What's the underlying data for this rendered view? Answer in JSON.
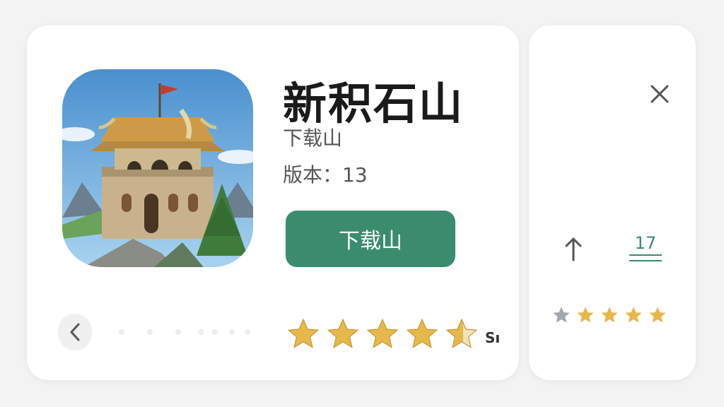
{
  "app": {
    "title": "新积石山",
    "subtitle": "下载山",
    "version_label": "版本：",
    "version_value": "13"
  },
  "actions": {
    "download_label": "下载山"
  },
  "rating": {
    "value": 4.5,
    "max": 5,
    "label": "Sı"
  },
  "side_panel": {
    "age_rating": "17",
    "rating_stars_filled": 4,
    "rating_stars_max": 5
  },
  "colors": {
    "accent": "#3b8c6e",
    "star": "#e6b84c",
    "star_empty": "#9aa0a6"
  },
  "icons": {
    "close": "close-icon",
    "back": "chevron-left-icon",
    "share": "share-icon",
    "star": "star-icon"
  }
}
